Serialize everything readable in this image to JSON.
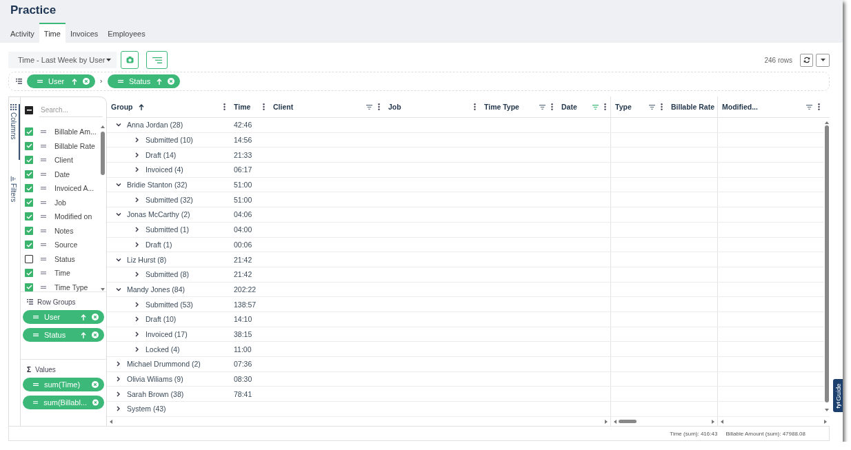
{
  "app": {
    "title": "Practice"
  },
  "tabs": [
    {
      "label": "Activity",
      "selected": false
    },
    {
      "label": "Time",
      "selected": true
    },
    {
      "label": "Invoices",
      "selected": false
    },
    {
      "label": "Employees",
      "selected": false
    }
  ],
  "toolbar": {
    "view_select": "Time - Last Week by User",
    "row_count": "246 rows"
  },
  "group_bar": {
    "pills": [
      {
        "label": "User",
        "sort_asc": true
      },
      {
        "label": "Status",
        "sort_asc": true
      }
    ]
  },
  "side_panel": {
    "tabs": [
      {
        "label": "Columns",
        "kind": "columns",
        "selected": true
      },
      {
        "label": "Filters",
        "kind": "filters",
        "selected": false
      }
    ],
    "select_all": {
      "partial": true
    },
    "search": {
      "placeholder": "Search..."
    },
    "columns": [
      {
        "label": "Billable Am...",
        "checked": true
      },
      {
        "label": "Billable Rate",
        "checked": true
      },
      {
        "label": "Client",
        "checked": true
      },
      {
        "label": "Date",
        "checked": true
      },
      {
        "label": "Invoiced A...",
        "checked": true
      },
      {
        "label": "Job",
        "checked": true
      },
      {
        "label": "Modified on",
        "checked": true
      },
      {
        "label": "Notes",
        "checked": true
      },
      {
        "label": "Source",
        "checked": true
      },
      {
        "label": "Status",
        "checked": false
      },
      {
        "label": "Time",
        "checked": true
      },
      {
        "label": "Time Type",
        "checked": true
      }
    ],
    "row_groups": {
      "title": "Row Groups",
      "pills": [
        {
          "label": "User",
          "sort_asc": true
        },
        {
          "label": "Status",
          "sort_asc": true
        }
      ]
    },
    "values": {
      "icon": "Σ",
      "title": "Values",
      "pills": [
        {
          "label": "sum(Time)"
        },
        {
          "label": "sum(Billabl..."
        }
      ]
    }
  },
  "grid": {
    "columns": [
      {
        "label": "Group",
        "kind": "pinned_left",
        "sort_asc": true,
        "filter": false,
        "menu": true
      },
      {
        "label": "Time",
        "kind": "pinned_left",
        "sort_asc": false,
        "filter": false,
        "menu": true
      },
      {
        "label": "Client",
        "kind": "pinned_left",
        "sort_asc": false,
        "filter": true,
        "filter_active": false,
        "menu": true
      },
      {
        "label": "Job",
        "kind": "pinned_left",
        "sort_asc": false,
        "filter": false,
        "menu": true
      },
      {
        "label": "Time Type",
        "kind": "pinned_left",
        "sort_asc": false,
        "filter": true,
        "filter_active": false,
        "menu": true
      },
      {
        "label": "Date",
        "kind": "pinned_left",
        "sort_asc": false,
        "filter": true,
        "filter_active": true,
        "menu": true
      },
      {
        "label": "Type",
        "kind": "scrolling",
        "sort_asc": false,
        "filter": true,
        "filter_active": false,
        "menu": true
      },
      {
        "label": "Billable Rate",
        "kind": "scrolling",
        "sort_asc": false,
        "filter": false,
        "menu": false
      },
      {
        "label": "Modified...",
        "kind": "pinned_right",
        "sort_asc": false,
        "filter": true,
        "filter_active": false,
        "menu": true
      }
    ],
    "rows": [
      {
        "label": "Anna Jordan (28)",
        "time": "42:46",
        "expanded": true,
        "children": [
          {
            "label": "Submitted (10)",
            "time": "14:56",
            "expanded": false
          },
          {
            "label": "Draft (14)",
            "time": "21:33",
            "expanded": false
          },
          {
            "label": "Invoiced (4)",
            "time": "06:17",
            "expanded": false
          }
        ]
      },
      {
        "label": "Bridie Stanton (32)",
        "time": "51:00",
        "expanded": true,
        "children": [
          {
            "label": "Submitted (32)",
            "time": "51:00",
            "expanded": false
          }
        ]
      },
      {
        "label": "Jonas McCarthy (2)",
        "time": "04:06",
        "expanded": true,
        "children": [
          {
            "label": "Submitted (1)",
            "time": "04:00",
            "expanded": false
          },
          {
            "label": "Draft (1)",
            "time": "00:06",
            "expanded": false
          }
        ]
      },
      {
        "label": "Liz Hurst (8)",
        "time": "21:42",
        "expanded": true,
        "children": [
          {
            "label": "Submitted (8)",
            "time": "21:42",
            "expanded": false
          }
        ]
      },
      {
        "label": "Mandy Jones (84)",
        "time": "202:22",
        "expanded": true,
        "children": [
          {
            "label": "Submitted (53)",
            "time": "138:57",
            "expanded": false
          },
          {
            "label": "Draft (10)",
            "time": "14:10",
            "expanded": false
          },
          {
            "label": "Invoiced (17)",
            "time": "38:15",
            "expanded": false
          },
          {
            "label": "Locked (4)",
            "time": "11:00",
            "expanded": false
          }
        ]
      },
      {
        "label": "Michael Drummond (2)",
        "time": "07:36",
        "expanded": false
      },
      {
        "label": "Olivia Wiliams (9)",
        "time": "08:30",
        "expanded": false
      },
      {
        "label": "Sarah Brown (38)",
        "time": "78:41",
        "expanded": false
      },
      {
        "label": "System (43)",
        "expanded": false
      }
    ]
  },
  "status_bar": [
    "Time (sum): 416:43",
    "Billable Amount (sum): 47988.08"
  ],
  "guide": {
    "logo": "fyi",
    "label": "Guide"
  }
}
